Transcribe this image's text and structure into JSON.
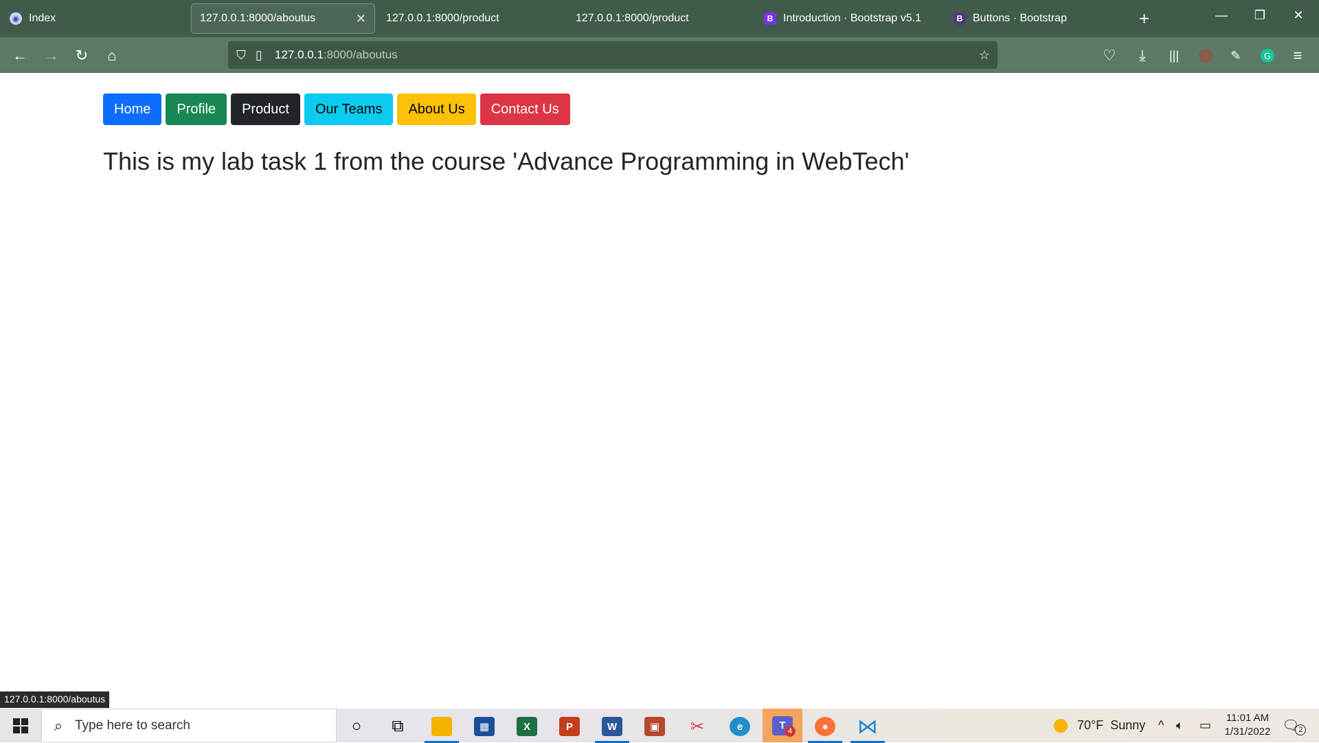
{
  "browser": {
    "tabs": [
      {
        "title": "Index",
        "icon": "shield-globe-icon"
      },
      {
        "title": "127.0.0.1:8000/aboutus",
        "active": true
      },
      {
        "title": "127.0.0.1:8000/product"
      },
      {
        "title": "127.0.0.1:8000/product"
      },
      {
        "title": "Introduction · Bootstrap v5.1",
        "icon_letter": "B"
      },
      {
        "title": "Buttons · Bootstrap",
        "icon_letter": "B"
      }
    ],
    "new_tab_label": "+",
    "url_host": "127.0.0.1",
    "url_path": ":8000/aboutus",
    "status_link": "127.0.0.1:8000/aboutus"
  },
  "page": {
    "buttons": [
      {
        "label": "Home",
        "variant": "primary",
        "color": "#0d6efd"
      },
      {
        "label": "Profile",
        "variant": "success",
        "color": "#198754"
      },
      {
        "label": "Product",
        "variant": "dark",
        "color": "#212529"
      },
      {
        "label": "Our Teams",
        "variant": "info",
        "color": "#0dcaf0"
      },
      {
        "label": "About Us",
        "variant": "warning",
        "color": "#ffc107"
      },
      {
        "label": "Contact Us",
        "variant": "danger",
        "color": "#dc3545"
      }
    ],
    "heading": "This is my lab task 1 from the course 'Advance Programming in WebTech'"
  },
  "taskbar": {
    "search_placeholder": "Type here to search",
    "teams_badge": "4",
    "weather": "70°F  Sunny",
    "time": "11:01 AM",
    "date": "1/31/2022",
    "notification_count": "2"
  },
  "colors": {
    "tabstrip": "#3f5c4a",
    "toolbar": "#5a7a66",
    "urlbar": "#3d5646"
  }
}
